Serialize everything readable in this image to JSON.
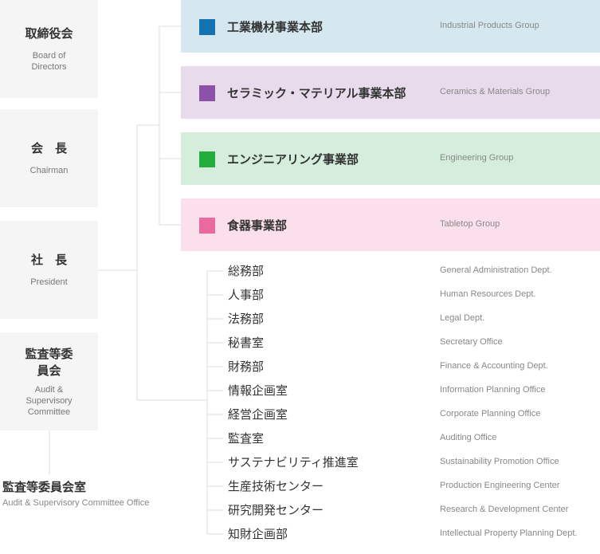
{
  "left_boxes": [
    {
      "ja": "取締役会",
      "en": "Board of Directors"
    },
    {
      "ja": "会　長",
      "en": "Chairman"
    },
    {
      "ja": "社　長",
      "en": "President"
    },
    {
      "ja": "監査等委員会",
      "en": "Audit & Supervisory Committee"
    }
  ],
  "office": {
    "ja": "監査等委員会室",
    "en": "Audit & Supervisory Committee Office"
  },
  "groups": [
    {
      "ja": "工業機材事業本部",
      "en": "Industrial Products Group",
      "bg": "#d5e8f0",
      "swatch": "#1273b0"
    },
    {
      "ja": "セラミック・マテリアル事業本部",
      "en": "Ceramics & Materials Group",
      "bg": "#e8dcec",
      "swatch": "#8c52a8"
    },
    {
      "ja": "エンジニアリング事業部",
      "en": "Engineering Group",
      "bg": "#d4eedb",
      "swatch": "#23ad3c"
    },
    {
      "ja": "食器事業部",
      "en": "Tabletop Group",
      "bg": "#fbdfea",
      "swatch": "#ea6aa0"
    }
  ],
  "departments": [
    {
      "ja": "総務部",
      "en": "General Administration Dept."
    },
    {
      "ja": "人事部",
      "en": "Human Resources Dept."
    },
    {
      "ja": "法務部",
      "en": "Legal Dept."
    },
    {
      "ja": "秘書室",
      "en": "Secretary Office"
    },
    {
      "ja": "財務部",
      "en": "Finance & Accounting Dept."
    },
    {
      "ja": "情報企画室",
      "en": "Information Planning Office"
    },
    {
      "ja": "経営企画室",
      "en": "Corporate Planning Office"
    },
    {
      "ja": "監査室",
      "en": "Auditing Office"
    },
    {
      "ja": "サステナビリティ推進室",
      "en": "Sustainability Promotion Office"
    },
    {
      "ja": "生産技術センター",
      "en": "Production Engineering Center"
    },
    {
      "ja": "研究開発センター",
      "en": "Research & Development Center"
    },
    {
      "ja": "知財企画部",
      "en": "Intellectual Property Planning Dept."
    }
  ],
  "line_color": "#dddddd"
}
